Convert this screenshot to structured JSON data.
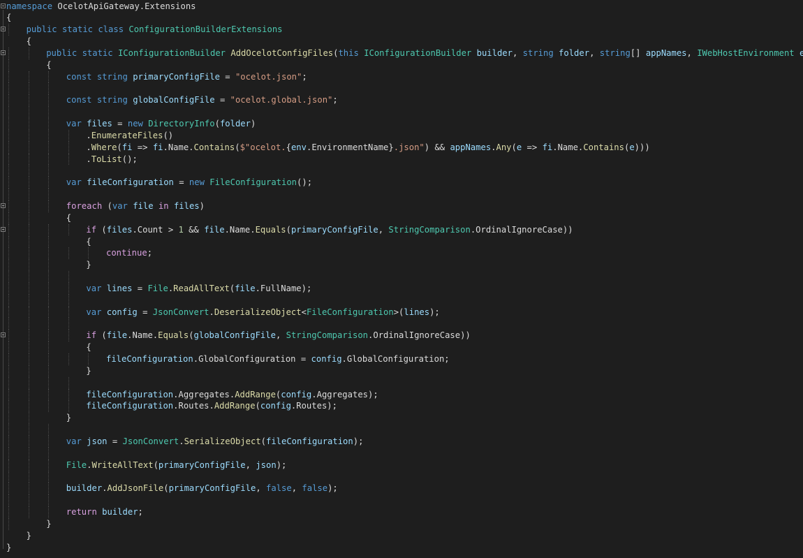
{
  "editor": {
    "language": "C#",
    "colors": {
      "background": "#1e1e1e",
      "keyword": "#569cd6",
      "type": "#4ec9b0",
      "method": "#dcdcaa",
      "string": "#d69d85",
      "variable": "#9cdcfe",
      "number": "#b5cea8",
      "control": "#d8a0df",
      "plain": "#dcdcdc"
    },
    "lines": [
      {
        "indent": 0,
        "fold": true,
        "tokens": [
          [
            "k",
            "namespace"
          ],
          [
            "p",
            " OcelotApiGateway.Extensions"
          ]
        ]
      },
      {
        "indent": 0,
        "tokens": [
          [
            "p",
            "{"
          ]
        ]
      },
      {
        "indent": 1,
        "fold": true,
        "tokens": [
          [
            "k",
            "public"
          ],
          [
            "p",
            " "
          ],
          [
            "k",
            "static"
          ],
          [
            "p",
            " "
          ],
          [
            "k",
            "class"
          ],
          [
            "p",
            " "
          ],
          [
            "t",
            "ConfigurationBuilderExtensions"
          ]
        ]
      },
      {
        "indent": 1,
        "tokens": [
          [
            "p",
            "{"
          ]
        ]
      },
      {
        "indent": 2,
        "fold": true,
        "tokens": [
          [
            "k",
            "public"
          ],
          [
            "p",
            " "
          ],
          [
            "k",
            "static"
          ],
          [
            "p",
            " "
          ],
          [
            "t",
            "IConfigurationBuilder"
          ],
          [
            "p",
            " "
          ],
          [
            "m",
            "AddOcelotConfigFiles"
          ],
          [
            "p",
            "("
          ],
          [
            "k",
            "this"
          ],
          [
            "p",
            " "
          ],
          [
            "t",
            "IConfigurationBuilder"
          ],
          [
            "p",
            " "
          ],
          [
            "v",
            "builder"
          ],
          [
            "p",
            ", "
          ],
          [
            "k",
            "string"
          ],
          [
            "p",
            " "
          ],
          [
            "v",
            "folder"
          ],
          [
            "p",
            ", "
          ],
          [
            "k",
            "string"
          ],
          [
            "p",
            "[] "
          ],
          [
            "v",
            "appNames"
          ],
          [
            "p",
            ", "
          ],
          [
            "t",
            "IWebHostEnvironment"
          ],
          [
            "p",
            " "
          ],
          [
            "v",
            "env"
          ],
          [
            "p",
            ")"
          ]
        ]
      },
      {
        "indent": 2,
        "tokens": [
          [
            "p",
            "{"
          ]
        ]
      },
      {
        "indent": 3,
        "tokens": [
          [
            "k",
            "const"
          ],
          [
            "p",
            " "
          ],
          [
            "k",
            "string"
          ],
          [
            "p",
            " "
          ],
          [
            "v",
            "primaryConfigFile"
          ],
          [
            "p",
            " = "
          ],
          [
            "s",
            "\"ocelot.json\""
          ],
          [
            "p",
            ";"
          ]
        ]
      },
      {
        "indent": 3,
        "tokens": []
      },
      {
        "indent": 3,
        "tokens": [
          [
            "k",
            "const"
          ],
          [
            "p",
            " "
          ],
          [
            "k",
            "string"
          ],
          [
            "p",
            " "
          ],
          [
            "v",
            "globalConfigFile"
          ],
          [
            "p",
            " = "
          ],
          [
            "s",
            "\"ocelot.global.json\""
          ],
          [
            "p",
            ";"
          ]
        ]
      },
      {
        "indent": 3,
        "tokens": []
      },
      {
        "indent": 3,
        "tokens": [
          [
            "k",
            "var"
          ],
          [
            "p",
            " "
          ],
          [
            "v",
            "files"
          ],
          [
            "p",
            " = "
          ],
          [
            "k",
            "new"
          ],
          [
            "p",
            " "
          ],
          [
            "t",
            "DirectoryInfo"
          ],
          [
            "p",
            "("
          ],
          [
            "v",
            "folder"
          ],
          [
            "p",
            ")"
          ]
        ]
      },
      {
        "indent": 4,
        "tokens": [
          [
            "p",
            "."
          ],
          [
            "m",
            "EnumerateFiles"
          ],
          [
            "p",
            "()"
          ]
        ]
      },
      {
        "indent": 4,
        "tokens": [
          [
            "p",
            "."
          ],
          [
            "m",
            "Where"
          ],
          [
            "p",
            "("
          ],
          [
            "v",
            "fi"
          ],
          [
            "p",
            " => "
          ],
          [
            "v",
            "fi"
          ],
          [
            "p",
            ".Name."
          ],
          [
            "m",
            "Contains"
          ],
          [
            "p",
            "("
          ],
          [
            "s",
            "$\"ocelot."
          ],
          [
            "p",
            "{"
          ],
          [
            "v",
            "env"
          ],
          [
            "p",
            ".EnvironmentName}"
          ],
          [
            "s",
            ".json\""
          ],
          [
            "p",
            ") && "
          ],
          [
            "v",
            "appNames"
          ],
          [
            "p",
            "."
          ],
          [
            "m",
            "Any"
          ],
          [
            "p",
            "("
          ],
          [
            "v",
            "e"
          ],
          [
            "p",
            " => "
          ],
          [
            "v",
            "fi"
          ],
          [
            "p",
            ".Name."
          ],
          [
            "m",
            "Contains"
          ],
          [
            "p",
            "("
          ],
          [
            "v",
            "e"
          ],
          [
            "p",
            ")))"
          ]
        ]
      },
      {
        "indent": 4,
        "tokens": [
          [
            "p",
            "."
          ],
          [
            "m",
            "ToList"
          ],
          [
            "p",
            "();"
          ]
        ]
      },
      {
        "indent": 3,
        "tokens": []
      },
      {
        "indent": 3,
        "tokens": [
          [
            "k",
            "var"
          ],
          [
            "p",
            " "
          ],
          [
            "v",
            "fileConfiguration"
          ],
          [
            "p",
            " = "
          ],
          [
            "k",
            "new"
          ],
          [
            "p",
            " "
          ],
          [
            "t",
            "FileConfiguration"
          ],
          [
            "p",
            "();"
          ]
        ]
      },
      {
        "indent": 3,
        "tokens": []
      },
      {
        "indent": 3,
        "fold": true,
        "tokens": [
          [
            "c",
            "foreach"
          ],
          [
            "p",
            " ("
          ],
          [
            "k",
            "var"
          ],
          [
            "p",
            " "
          ],
          [
            "v",
            "file"
          ],
          [
            "p",
            " "
          ],
          [
            "c",
            "in"
          ],
          [
            "p",
            " "
          ],
          [
            "v",
            "files"
          ],
          [
            "p",
            ")"
          ]
        ]
      },
      {
        "indent": 3,
        "tokens": [
          [
            "p",
            "{"
          ]
        ]
      },
      {
        "indent": 4,
        "fold": true,
        "tokens": [
          [
            "c",
            "if"
          ],
          [
            "p",
            " ("
          ],
          [
            "v",
            "files"
          ],
          [
            "p",
            ".Count > "
          ],
          [
            "n",
            "1"
          ],
          [
            "p",
            " && "
          ],
          [
            "v",
            "file"
          ],
          [
            "p",
            ".Name."
          ],
          [
            "m",
            "Equals"
          ],
          [
            "p",
            "("
          ],
          [
            "v",
            "primaryConfigFile"
          ],
          [
            "p",
            ", "
          ],
          [
            "t",
            "StringComparison"
          ],
          [
            "p",
            ".OrdinalIgnoreCase))"
          ]
        ]
      },
      {
        "indent": 4,
        "tokens": [
          [
            "p",
            "{"
          ]
        ]
      },
      {
        "indent": 5,
        "tokens": [
          [
            "c",
            "continue"
          ],
          [
            "p",
            ";"
          ]
        ]
      },
      {
        "indent": 4,
        "tokens": [
          [
            "p",
            "}"
          ]
        ]
      },
      {
        "indent": 4,
        "tokens": []
      },
      {
        "indent": 4,
        "tokens": [
          [
            "k",
            "var"
          ],
          [
            "p",
            " "
          ],
          [
            "v",
            "lines"
          ],
          [
            "p",
            " = "
          ],
          [
            "t",
            "File"
          ],
          [
            "p",
            "."
          ],
          [
            "m",
            "ReadAllText"
          ],
          [
            "p",
            "("
          ],
          [
            "v",
            "file"
          ],
          [
            "p",
            ".FullName);"
          ]
        ]
      },
      {
        "indent": 4,
        "tokens": []
      },
      {
        "indent": 4,
        "tokens": [
          [
            "k",
            "var"
          ],
          [
            "p",
            " "
          ],
          [
            "v",
            "config"
          ],
          [
            "p",
            " = "
          ],
          [
            "t",
            "JsonConvert"
          ],
          [
            "p",
            "."
          ],
          [
            "m",
            "DeserializeObject"
          ],
          [
            "p",
            "<"
          ],
          [
            "t",
            "FileConfiguration"
          ],
          [
            "p",
            ">("
          ],
          [
            "v",
            "lines"
          ],
          [
            "p",
            ");"
          ]
        ]
      },
      {
        "indent": 4,
        "tokens": []
      },
      {
        "indent": 4,
        "fold": true,
        "tokens": [
          [
            "c",
            "if"
          ],
          [
            "p",
            " ("
          ],
          [
            "v",
            "file"
          ],
          [
            "p",
            ".Name."
          ],
          [
            "m",
            "Equals"
          ],
          [
            "p",
            "("
          ],
          [
            "v",
            "globalConfigFile"
          ],
          [
            "p",
            ", "
          ],
          [
            "t",
            "StringComparison"
          ],
          [
            "p",
            ".OrdinalIgnoreCase))"
          ]
        ]
      },
      {
        "indent": 4,
        "tokens": [
          [
            "p",
            "{"
          ]
        ]
      },
      {
        "indent": 5,
        "tokens": [
          [
            "v",
            "fileConfiguration"
          ],
          [
            "p",
            ".GlobalConfiguration = "
          ],
          [
            "v",
            "config"
          ],
          [
            "p",
            ".GlobalConfiguration;"
          ]
        ]
      },
      {
        "indent": 4,
        "tokens": [
          [
            "p",
            "}"
          ]
        ]
      },
      {
        "indent": 4,
        "tokens": []
      },
      {
        "indent": 4,
        "tokens": [
          [
            "v",
            "fileConfiguration"
          ],
          [
            "p",
            ".Aggregates."
          ],
          [
            "m",
            "AddRange"
          ],
          [
            "p",
            "("
          ],
          [
            "v",
            "config"
          ],
          [
            "p",
            ".Aggregates);"
          ]
        ]
      },
      {
        "indent": 4,
        "tokens": [
          [
            "v",
            "fileConfiguration"
          ],
          [
            "p",
            ".Routes."
          ],
          [
            "m",
            "AddRange"
          ],
          [
            "p",
            "("
          ],
          [
            "v",
            "config"
          ],
          [
            "p",
            ".Routes);"
          ]
        ]
      },
      {
        "indent": 3,
        "tokens": [
          [
            "p",
            "}"
          ]
        ]
      },
      {
        "indent": 3,
        "tokens": []
      },
      {
        "indent": 3,
        "tokens": [
          [
            "k",
            "var"
          ],
          [
            "p",
            " "
          ],
          [
            "v",
            "json"
          ],
          [
            "p",
            " = "
          ],
          [
            "t",
            "JsonConvert"
          ],
          [
            "p",
            "."
          ],
          [
            "m",
            "SerializeObject"
          ],
          [
            "p",
            "("
          ],
          [
            "v",
            "fileConfiguration"
          ],
          [
            "p",
            ");"
          ]
        ]
      },
      {
        "indent": 3,
        "tokens": []
      },
      {
        "indent": 3,
        "tokens": [
          [
            "t",
            "File"
          ],
          [
            "p",
            "."
          ],
          [
            "m",
            "WriteAllText"
          ],
          [
            "p",
            "("
          ],
          [
            "v",
            "primaryConfigFile"
          ],
          [
            "p",
            ", "
          ],
          [
            "v",
            "json"
          ],
          [
            "p",
            ");"
          ]
        ]
      },
      {
        "indent": 3,
        "tokens": []
      },
      {
        "indent": 3,
        "tokens": [
          [
            "v",
            "builder"
          ],
          [
            "p",
            "."
          ],
          [
            "m",
            "AddJsonFile"
          ],
          [
            "p",
            "("
          ],
          [
            "v",
            "primaryConfigFile"
          ],
          [
            "p",
            ", "
          ],
          [
            "k",
            "false"
          ],
          [
            "p",
            ", "
          ],
          [
            "k",
            "false"
          ],
          [
            "p",
            ");"
          ]
        ]
      },
      {
        "indent": 3,
        "tokens": []
      },
      {
        "indent": 3,
        "tokens": [
          [
            "c",
            "return"
          ],
          [
            "p",
            " "
          ],
          [
            "v",
            "builder"
          ],
          [
            "p",
            ";"
          ]
        ]
      },
      {
        "indent": 2,
        "tokens": [
          [
            "p",
            "}"
          ]
        ]
      },
      {
        "indent": 1,
        "tokens": [
          [
            "p",
            "}"
          ]
        ]
      },
      {
        "indent": 0,
        "tokens": [
          [
            "p",
            "}"
          ]
        ]
      }
    ]
  }
}
